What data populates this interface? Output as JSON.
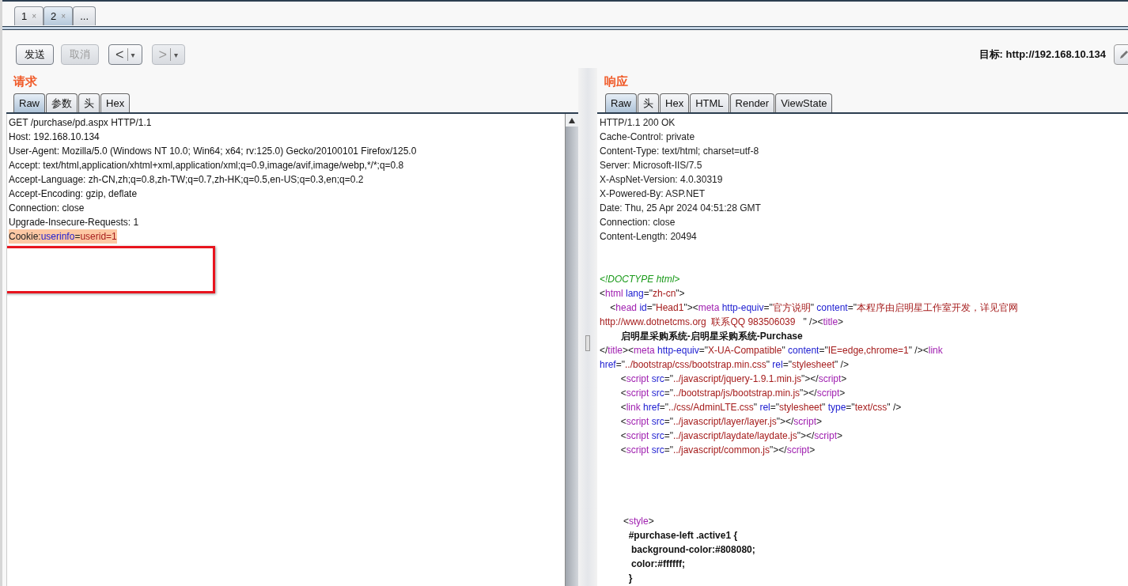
{
  "session_tabs": [
    {
      "label": "1",
      "close": "×",
      "selected": false
    },
    {
      "label": "2",
      "close": "×",
      "selected": true
    },
    {
      "label": "...",
      "selected": false
    }
  ],
  "toolbar": {
    "buttons": [
      {
        "kind": "text",
        "label": "发送",
        "disabled": false
      },
      {
        "kind": "text",
        "label": "取消",
        "disabled": true
      },
      {
        "kind": "nav",
        "label": "<",
        "caret": "▾",
        "disabled": false
      },
      {
        "kind": "nav",
        "label": ">",
        "caret": "▾",
        "disabled": true
      }
    ],
    "target": "目标: http://192.168.10.134"
  },
  "request": {
    "title": "请求",
    "tabs": [
      {
        "label": "Raw",
        "selected": true
      },
      {
        "label": "参数",
        "selected": false
      },
      {
        "label": "头",
        "selected": false
      },
      {
        "label": "Hex",
        "selected": false
      }
    ],
    "lines": [
      "GET /purchase/pd.aspx HTTP/1.1",
      "Host: 192.168.10.134",
      "User-Agent: Mozilla/5.0 (Windows NT 10.0; Win64; x64; rv:125.0) Gecko/20100101 Firefox/125.0",
      "Accept: text/html,application/xhtml+xml,application/xml;q=0.9,image/avif,image/webp,*/*;q=0.8",
      "Accept-Language: zh-CN,zh;q=0.8,zh-TW;q=0.7,zh-HK;q=0.5,en-US;q=0.3,en;q=0.2",
      "Accept-Encoding: gzip, deflate",
      "Connection: close",
      "Upgrade-Insecure-Requests: 1"
    ],
    "highlighted_line": [
      {
        "kind": "punct",
        "text": "Cookie:"
      },
      {
        "kind": "attr",
        "text": "userinfo"
      },
      {
        "kind": "punct",
        "text": "="
      },
      {
        "kind": "value",
        "text": "userid=1"
      }
    ]
  },
  "response": {
    "title": "响应",
    "tabs": [
      {
        "label": "Raw",
        "selected": true
      },
      {
        "label": "头",
        "selected": false
      },
      {
        "label": "Hex",
        "selected": false
      },
      {
        "label": "HTML",
        "selected": false
      },
      {
        "label": "Render",
        "selected": false
      },
      {
        "label": "ViewState",
        "selected": false
      }
    ],
    "sections": [
      [
        [
          {
            "kind": "plain",
            "text": "HTTP/1.1 200 OK"
          }
        ],
        [
          {
            "kind": "plain",
            "text": "Cache-Control: private"
          }
        ],
        [
          {
            "kind": "plain",
            "text": "Content-Type: text/html; charset=utf-8"
          }
        ],
        [
          {
            "kind": "plain",
            "text": "Server: Microsoft-IIS/7.5"
          }
        ],
        [
          {
            "kind": "plain",
            "text": "X-AspNet-Version: 4.0.30319"
          }
        ],
        [
          {
            "kind": "plain",
            "text": "X-Powered-By: ASP.NET"
          }
        ],
        [
          {
            "kind": "plain",
            "text": "Date: Thu, 25 Apr 2024 04:51:28 GMT"
          }
        ],
        [
          {
            "kind": "plain",
            "text": "Connection: close"
          }
        ],
        [
          {
            "kind": "plain",
            "text": "Content-Length: 20494"
          }
        ]
      ],
      [
        [
          {
            "kind": "comment",
            "text": "<!DOCTYPE html>"
          }
        ],
        [
          {
            "kind": "punct",
            "text": "<"
          },
          {
            "kind": "tag",
            "text": "html"
          },
          {
            "kind": "attr",
            "text": " lang"
          },
          {
            "kind": "punct",
            "text": "=\""
          },
          {
            "kind": "value",
            "text": "zh-cn"
          },
          {
            "kind": "punct",
            "text": "\">"
          }
        ],
        [
          {
            "kind": "punct",
            "text": "    <"
          },
          {
            "kind": "tag",
            "text": "head"
          },
          {
            "kind": "attr",
            "text": " id"
          },
          {
            "kind": "punct",
            "text": "=\""
          },
          {
            "kind": "value",
            "text": "Head1"
          },
          {
            "kind": "punct",
            "text": "\"><"
          },
          {
            "kind": "tag",
            "text": "meta"
          },
          {
            "kind": "attr",
            "text": " http-equiv"
          },
          {
            "kind": "punct",
            "text": "=\""
          },
          {
            "kind": "value",
            "text": "官方说明"
          },
          {
            "kind": "punct",
            "text": "\""
          },
          {
            "kind": "attr",
            "text": " content"
          },
          {
            "kind": "punct",
            "text": "=\""
          },
          {
            "kind": "value",
            "text": "本程序由启明星工作室开发，详见官网"
          }
        ],
        [
          {
            "kind": "value",
            "text": "http://www.dotnetcms.org  联系QQ 983506039   "
          },
          {
            "kind": "punct",
            "text": "\" /><"
          },
          {
            "kind": "tag",
            "text": "title"
          },
          {
            "kind": "punct",
            "text": ">"
          }
        ],
        [
          {
            "kind": "bold",
            "text": "        启明星采购系统-启明星采购系统-Purchase"
          }
        ],
        [
          {
            "kind": "punct",
            "text": "</"
          },
          {
            "kind": "tag",
            "text": "title"
          },
          {
            "kind": "punct",
            "text": "><"
          },
          {
            "kind": "tag",
            "text": "meta"
          },
          {
            "kind": "attr",
            "text": " http-equiv"
          },
          {
            "kind": "punct",
            "text": "=\""
          },
          {
            "kind": "value",
            "text": "X-UA-Compatible"
          },
          {
            "kind": "punct",
            "text": "\""
          },
          {
            "kind": "attr",
            "text": " content"
          },
          {
            "kind": "punct",
            "text": "=\""
          },
          {
            "kind": "value",
            "text": "IE=edge,chrome=1"
          },
          {
            "kind": "punct",
            "text": "\" /><"
          },
          {
            "kind": "tag",
            "text": "link"
          }
        ],
        [
          {
            "kind": "attr",
            "text": "href"
          },
          {
            "kind": "punct",
            "text": "=\""
          },
          {
            "kind": "value",
            "text": "../bootstrap/css/bootstrap.min.css"
          },
          {
            "kind": "punct",
            "text": "\""
          },
          {
            "kind": "attr",
            "text": " rel"
          },
          {
            "kind": "punct",
            "text": "=\""
          },
          {
            "kind": "value",
            "text": "stylesheet"
          },
          {
            "kind": "punct",
            "text": "\" />"
          }
        ],
        [
          {
            "kind": "punct",
            "text": "        <"
          },
          {
            "kind": "tag",
            "text": "script"
          },
          {
            "kind": "attr",
            "text": " src"
          },
          {
            "kind": "punct",
            "text": "=\""
          },
          {
            "kind": "value",
            "text": "../javascript/jquery-1.9.1.min.js"
          },
          {
            "kind": "punct",
            "text": "\"></"
          },
          {
            "kind": "tag",
            "text": "script"
          },
          {
            "kind": "punct",
            "text": ">"
          }
        ],
        [
          {
            "kind": "punct",
            "text": "        <"
          },
          {
            "kind": "tag",
            "text": "script"
          },
          {
            "kind": "attr",
            "text": " src"
          },
          {
            "kind": "punct",
            "text": "=\""
          },
          {
            "kind": "value",
            "text": "../bootstrap/js/bootstrap.min.js"
          },
          {
            "kind": "punct",
            "text": "\"></"
          },
          {
            "kind": "tag",
            "text": "script"
          },
          {
            "kind": "punct",
            "text": ">"
          }
        ],
        [
          {
            "kind": "punct",
            "text": "        <"
          },
          {
            "kind": "tag",
            "text": "link"
          },
          {
            "kind": "attr",
            "text": " href"
          },
          {
            "kind": "punct",
            "text": "=\""
          },
          {
            "kind": "value",
            "text": "../css/AdminLTE.css"
          },
          {
            "kind": "punct",
            "text": "\""
          },
          {
            "kind": "attr",
            "text": " rel"
          },
          {
            "kind": "punct",
            "text": "=\""
          },
          {
            "kind": "value",
            "text": "stylesheet"
          },
          {
            "kind": "punct",
            "text": "\""
          },
          {
            "kind": "attr",
            "text": " type"
          },
          {
            "kind": "punct",
            "text": "=\""
          },
          {
            "kind": "value",
            "text": "text/css"
          },
          {
            "kind": "punct",
            "text": "\" />"
          }
        ],
        [
          {
            "kind": "punct",
            "text": "        <"
          },
          {
            "kind": "tag",
            "text": "script"
          },
          {
            "kind": "attr",
            "text": " src"
          },
          {
            "kind": "punct",
            "text": "=\""
          },
          {
            "kind": "value",
            "text": "../javascript/layer/layer.js"
          },
          {
            "kind": "punct",
            "text": "\"></"
          },
          {
            "kind": "tag",
            "text": "script"
          },
          {
            "kind": "punct",
            "text": ">"
          }
        ],
        [
          {
            "kind": "punct",
            "text": "        <"
          },
          {
            "kind": "tag",
            "text": "script"
          },
          {
            "kind": "attr",
            "text": " src"
          },
          {
            "kind": "punct",
            "text": "=\""
          },
          {
            "kind": "value",
            "text": "../javascript/laydate/laydate.js"
          },
          {
            "kind": "punct",
            "text": "\"></"
          },
          {
            "kind": "tag",
            "text": "script"
          },
          {
            "kind": "punct",
            "text": ">"
          }
        ],
        [
          {
            "kind": "punct",
            "text": "        <"
          },
          {
            "kind": "tag",
            "text": "script"
          },
          {
            "kind": "attr",
            "text": " src"
          },
          {
            "kind": "punct",
            "text": "=\""
          },
          {
            "kind": "value",
            "text": "../javascript/common.js"
          },
          {
            "kind": "punct",
            "text": "\"></"
          },
          {
            "kind": "tag",
            "text": "script"
          },
          {
            "kind": "punct",
            "text": ">"
          }
        ]
      ],
      [
        [
          {
            "kind": "punct",
            "text": "         <"
          },
          {
            "kind": "tag",
            "text": "style"
          },
          {
            "kind": "punct",
            "text": ">"
          }
        ],
        [
          {
            "kind": "bold",
            "text": "           #purchase-left .active1 {"
          }
        ],
        [
          {
            "kind": "bold",
            "text": "            background-color:#808080;"
          }
        ],
        [
          {
            "kind": "bold",
            "text": "            color:#ffffff;"
          }
        ],
        [
          {
            "kind": "bold",
            "text": "           }"
          }
        ]
      ]
    ]
  }
}
